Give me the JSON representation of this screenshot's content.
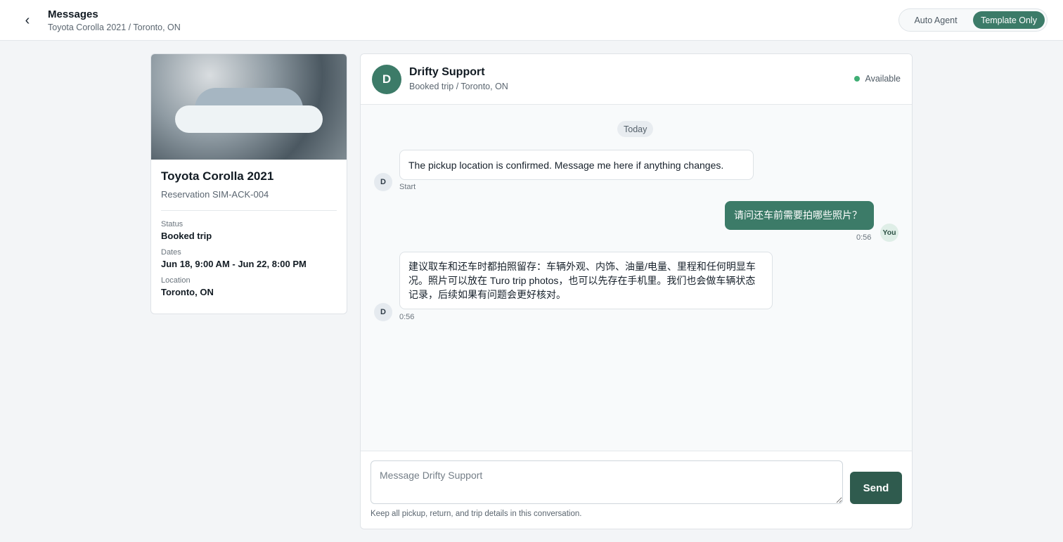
{
  "topbar": {
    "back_icon": "chevron-left-icon",
    "title": "Messages",
    "subtitle": "Toyota Corolla 2021 / Toronto, ON",
    "modes": [
      {
        "label": "Auto Agent",
        "active": false
      },
      {
        "label": "Template Only",
        "active": true
      }
    ]
  },
  "car": {
    "name": "Toyota Corolla 2021",
    "reservation": "Reservation SIM-ACK-004",
    "details": [
      {
        "label": "Status",
        "value": "Booked trip"
      },
      {
        "label": "Dates",
        "value": "Jun 18, 9:00 AM - Jun 22, 8:00 PM"
      },
      {
        "label": "Location",
        "value": "Toronto, ON"
      }
    ]
  },
  "chat": {
    "avatar_initial": "D",
    "name": "Drifty Support",
    "subtitle": "Booked trip / Toronto, ON",
    "status": "Available",
    "status_color": "#3fae74",
    "day_label": "Today",
    "messages": [
      {
        "sender": "D",
        "direction": "incoming",
        "text": "The pickup location is confirmed. Message me here if anything changes.",
        "time": "Start"
      },
      {
        "sender": "You",
        "direction": "outgoing",
        "text": "请问还车前需要拍哪些照片？",
        "time": "0:56"
      },
      {
        "sender": "D",
        "direction": "incoming",
        "text": "建议取车和还车时都拍照留存：车辆外观、内饰、油量/电量、里程和任何明显车况。照片可以放在 Turo trip photos，也可以先存在手机里。我们也会做车辆状态记录，后续如果有问题会更好核对。",
        "time": "0:56"
      }
    ]
  },
  "composer": {
    "placeholder": "Message Drifty Support",
    "value": "",
    "send_label": "Send",
    "hint": "Keep all pickup, return, and trip details in this conversation."
  },
  "colors": {
    "accent": "#3c7b68",
    "send_button": "#2f5b4e"
  }
}
